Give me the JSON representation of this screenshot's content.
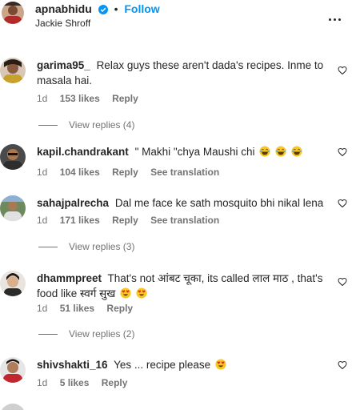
{
  "header": {
    "username": "apnabhidu",
    "separator": "•",
    "follow_label": "Follow",
    "subtitle": "Jackie Shroff"
  },
  "comments": [
    {
      "username": "garima95_",
      "text": "Relax guys these aren't dada's recipes. Inme to masala hai.",
      "time": "1d",
      "likes": "153 likes",
      "reply_label": "Reply",
      "view_replies": "View replies (4)"
    },
    {
      "username": "kapil.chandrakant",
      "text": "\" Makhi \"chya Maushi chi",
      "emoji": [
        "laughing-emoji",
        "laughing-emoji",
        "laughing-emoji"
      ],
      "time": "1d",
      "likes": "104 likes",
      "reply_label": "Reply",
      "translation_label": "See translation"
    },
    {
      "username": "sahajpalrecha",
      "text": "Dal me face ke sath mosquito bhi nikal lena",
      "time": "1d",
      "likes": "171 likes",
      "reply_label": "Reply",
      "translation_label": "See translation",
      "view_replies": "View replies (3)"
    },
    {
      "username": "dhammpreet",
      "text": "That's not आंबट चूका, its called लाल माठ , that's food like स्वर्ग सुख",
      "emoji": [
        "heart-eyes-emoji",
        "heart-eyes-emoji"
      ],
      "time": "1d",
      "likes": "51 likes",
      "reply_label": "Reply",
      "view_replies": "View replies (2)"
    },
    {
      "username": "shivshakti_16",
      "text": "Yes ... recipe please",
      "emoji": [
        "heart-eyes-emoji"
      ],
      "time": "1d",
      "likes": "5 likes",
      "reply_label": "Reply"
    }
  ]
}
